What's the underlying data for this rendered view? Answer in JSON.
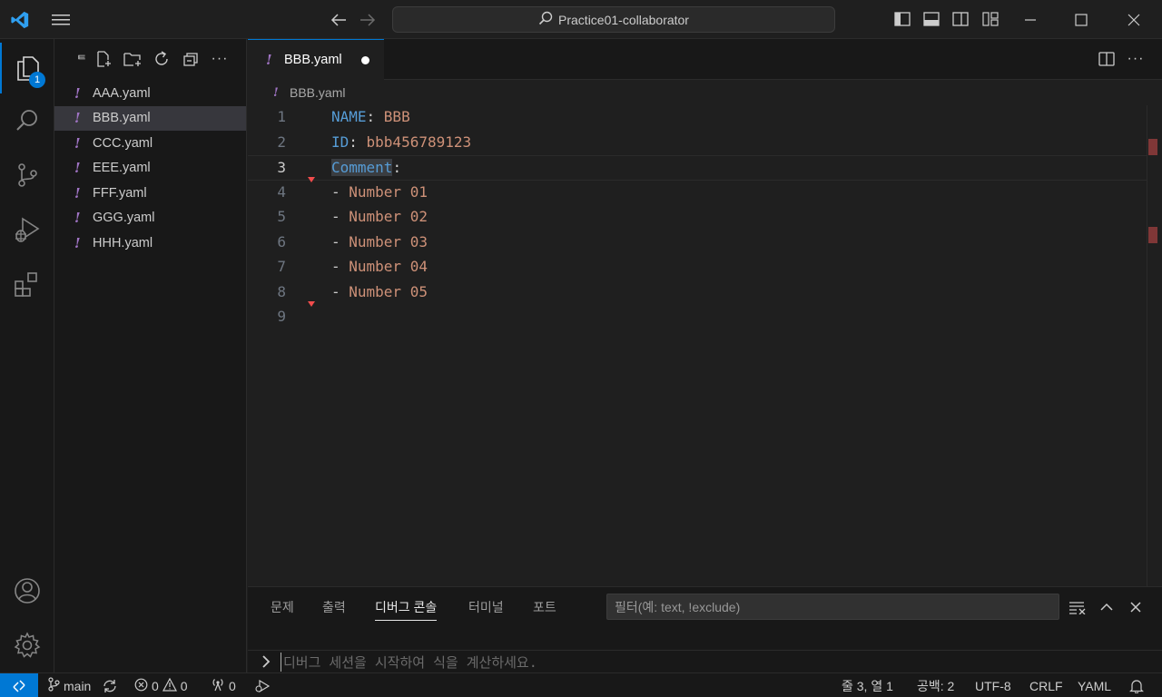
{
  "titlebar": {
    "search_text": "Practice01-collaborator",
    "icons": [
      "vscode-logo-icon",
      "menu-icon",
      "arrow-left-icon",
      "arrow-right-icon",
      "search-icon",
      "toggle-sidebar-icon",
      "toggle-panel-icon",
      "toggle-secondary-sidebar-icon",
      "customize-layout-icon",
      "minimize-icon",
      "maximize-icon",
      "close-icon"
    ]
  },
  "activity_bar": {
    "explorer_badge": "1",
    "items": [
      "explorer",
      "search",
      "source-control",
      "run-debug",
      "extensions",
      "accounts",
      "manage"
    ]
  },
  "sidebar": {
    "toolbar_glyph": "ᄐ",
    "files": [
      {
        "name": "AAA.yaml",
        "selected": false
      },
      {
        "name": "BBB.yaml",
        "selected": true
      },
      {
        "name": "CCC.yaml",
        "selected": false
      },
      {
        "name": "EEE.yaml",
        "selected": false
      },
      {
        "name": "FFF.yaml",
        "selected": false
      },
      {
        "name": "GGG.yaml",
        "selected": false
      },
      {
        "name": "HHH.yaml",
        "selected": false
      }
    ],
    "yaml_mark": "!"
  },
  "editor": {
    "tab_label": "BBB.yaml",
    "breadcrumb": "BBB.yaml",
    "current_line": 3,
    "lines": [
      {
        "n": "1",
        "key": "NAME",
        "sep": ": ",
        "val": "BBB"
      },
      {
        "n": "2",
        "key": "ID",
        "sep": ": ",
        "val": "bbb456789123"
      },
      {
        "n": "3",
        "key": "Comment",
        "sep": ":",
        "val": ""
      },
      {
        "n": "4",
        "dash": "- ",
        "val": "Number 01"
      },
      {
        "n": "5",
        "dash": "- ",
        "val": "Number 02"
      },
      {
        "n": "6",
        "dash": "- ",
        "val": "Number 03"
      },
      {
        "n": "7",
        "dash": "- ",
        "val": "Number 04"
      },
      {
        "n": "8",
        "dash": "- ",
        "val": "Number 05"
      },
      {
        "n": "9"
      }
    ]
  },
  "panel": {
    "tabs": [
      "문제",
      "출력",
      "디버그 콘솔",
      "터미널",
      "포트"
    ],
    "active_tab": "디버그 콘솔",
    "filter_placeholder": "필터(예: text, !exclude)",
    "repl_placeholder": "디버그 세션을 시작하여 식을 계산하세요."
  },
  "statusbar": {
    "branch": "main",
    "errors": "0",
    "warnings": "0",
    "ports": "0",
    "cursor": "줄 3, 열 1",
    "indent": "공백: 2",
    "encoding": "UTF-8",
    "eol": "CRLF",
    "language": "YAML"
  },
  "colors": {
    "accent": "#0078d4",
    "yaml_key": "#569cd6",
    "yaml_value": "#ce9178",
    "yaml_icon": "#a074c4"
  }
}
